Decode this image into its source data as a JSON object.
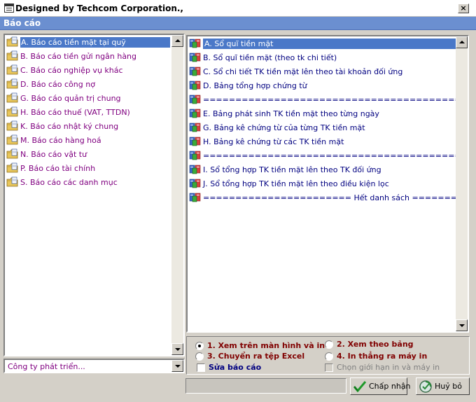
{
  "window": {
    "title": "Designed by Techcom Corporation.,",
    "close_label": "×"
  },
  "header": {
    "title": "Báo cáo"
  },
  "left_list": {
    "items": [
      {
        "label": "A. Báo cáo tiền mặt tại quỹ",
        "selected": true
      },
      {
        "label": "B. Báo cáo tiền gửi ngân hàng"
      },
      {
        "label": "C. Báo cáo nghiệp vụ khác"
      },
      {
        "label": "D. Báo cáo công nợ"
      },
      {
        "label": "G. Báo cáo quản trị chung"
      },
      {
        "label": "H. Báo cáo thuế (VAT, TTDN)"
      },
      {
        "label": "K. Báo cáo nhật ký chung"
      },
      {
        "label": "M. Báo cáo hàng hoá"
      },
      {
        "label": "N. Báo cáo vật tư"
      },
      {
        "label": "P. Báo cáo tài chính"
      },
      {
        "label": "S. Báo cáo các danh mục"
      }
    ]
  },
  "right_list": {
    "items": [
      {
        "label": "A. Sổ quĩ tiền mặt",
        "selected": true
      },
      {
        "label": "B. Sổ quĩ tiền mặt (theo tk chi tiết)"
      },
      {
        "label": "C. Sổ chi tiết TK tiền mặt lên theo tài khoản đối ứng"
      },
      {
        "label": "D. Bảng tổng hợp chứng từ"
      },
      {
        "label": "=================================================================="
      },
      {
        "label": "E. Bảng phát sinh TK tiền mặt theo từng ngày"
      },
      {
        "label": "G. Bảng kê chứng từ của từng TK tiền mặt"
      },
      {
        "label": "H. Bảng kê chứng từ các TK tiền mặt"
      },
      {
        "label": "=================================================================="
      },
      {
        "label": "I. Sổ tổng hợp TK tiền mặt lên theo TK đối ứng"
      },
      {
        "label": "J. Sổ tổng hợp TK tiền mặt lên theo điều kiện lọc"
      },
      {
        "label": "======================= Hết danh sách ========================"
      }
    ]
  },
  "combo": {
    "value": "Công ty phát triển..."
  },
  "options": {
    "opt1": "1. Xem trên màn hình và in",
    "opt2": "2. Xem theo bảng",
    "opt3": "3. Chuyển ra tệp Excel",
    "opt4": "4. In thẳng ra máy in",
    "edit": "Sửa báo cáo",
    "limit": "Chọn giới hạn in và máy in"
  },
  "buttons": {
    "ok": "Chấp nhận",
    "cancel": "Huỷ bỏ"
  },
  "colors": {
    "header": "#6b8fd0",
    "selection": "#4a78c8",
    "item_text_left": "#800080",
    "item_text_right": "#000080"
  }
}
